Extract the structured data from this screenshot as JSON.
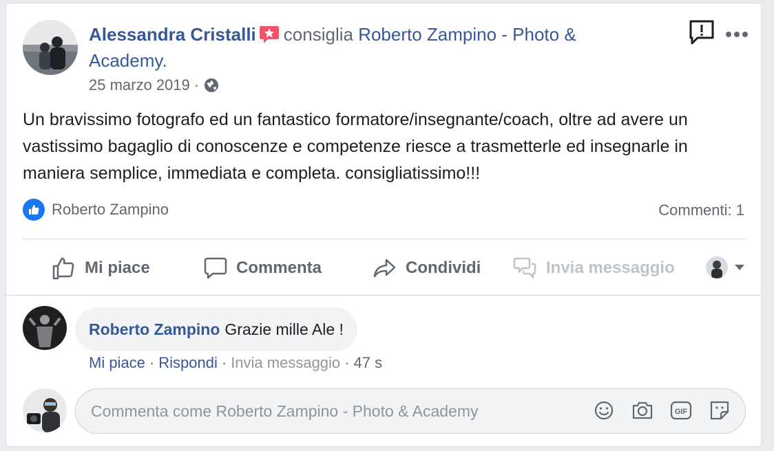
{
  "post": {
    "author_name": "Alessandra Cristalli",
    "recommend_verb": "consiglia",
    "page_name": "Roberto Zampino - Photo & Academy.",
    "date": "25 marzo 2019",
    "date_sep": "·",
    "privacy_icon": "globe-icon",
    "text": "Un bravissimo fotografo ed un fantastico formatore/insegnante/coach, oltre ad avere un vastissimo bagaglio di conoscenze e competenze riesce a trasmetterle ed insegnarle in maniera semplice, immediata e completa. consigliatissimo!!!"
  },
  "reactions": {
    "liked_by": "Roberto Zampino",
    "comments_label": "Commenti: 1"
  },
  "actions": {
    "like": "Mi piace",
    "comment": "Commenta",
    "share": "Condividi",
    "message": "Invia messaggio"
  },
  "comment": {
    "author": "Roberto Zampino",
    "text": "Grazie mille Ale !",
    "like": "Mi piace",
    "reply": "Rispondi",
    "message": "Invia messaggio",
    "time": "47 s",
    "sep": "·"
  },
  "composer": {
    "placeholder": "Commenta come Roberto Zampino - Photo & Academy"
  },
  "colors": {
    "link": "#365899",
    "secondary": "#606770",
    "like_blue": "#1877f2",
    "badge_pink": "#f25268"
  }
}
